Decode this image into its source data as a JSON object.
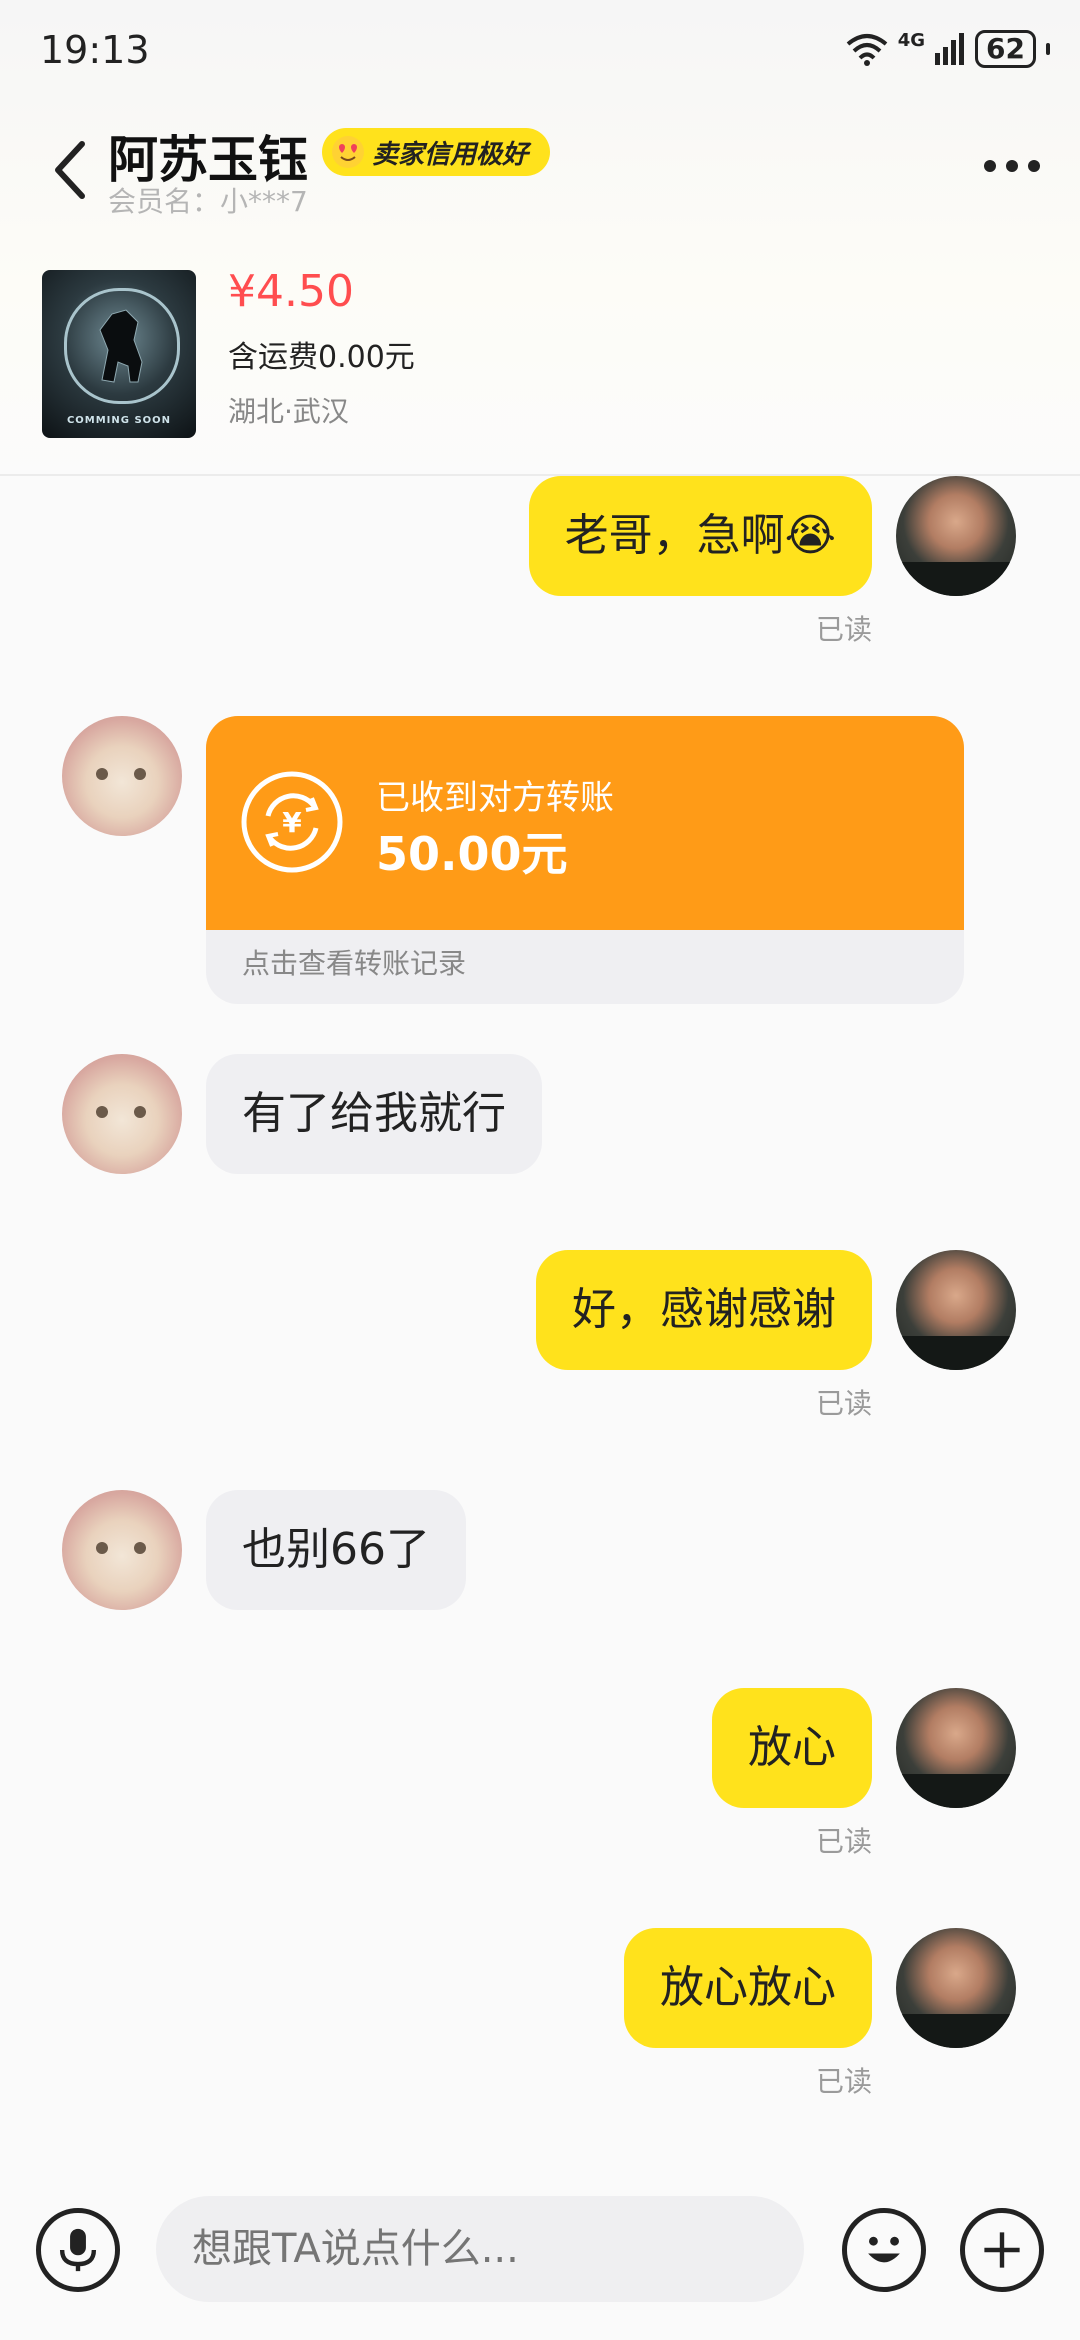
{
  "status_bar": {
    "time": "19:13",
    "network": "4G",
    "battery": "62"
  },
  "header": {
    "name": "阿苏玉钰",
    "badge": "卖家信用极好",
    "member_label": "会员名：小***7"
  },
  "product": {
    "image_caption": "COMMING SOON",
    "price": "¥4.50",
    "shipping": "含运费0.00元",
    "location": "湖北·武汉"
  },
  "messages": [
    {
      "from": "me",
      "text": "老哥，急啊😭",
      "status": "已读"
    },
    {
      "from": "other",
      "type": "transfer",
      "title": "已收到对方转账",
      "amount": "50.00元",
      "link": "点击查看转账记录"
    },
    {
      "from": "other",
      "text": "有了给我就行"
    },
    {
      "from": "me",
      "text": "好，感谢感谢",
      "status": "已读"
    },
    {
      "from": "other",
      "text": "也别66了"
    },
    {
      "from": "me",
      "text": "放心",
      "status": "已读"
    },
    {
      "from": "me",
      "text": "放心放心",
      "status": "已读"
    }
  ],
  "input": {
    "placeholder": "想跟TA说点什么..."
  },
  "colors": {
    "accent_yellow": "#ffe21c",
    "transfer_orange": "#ff9b17",
    "price_red": "#ff4d4f"
  }
}
